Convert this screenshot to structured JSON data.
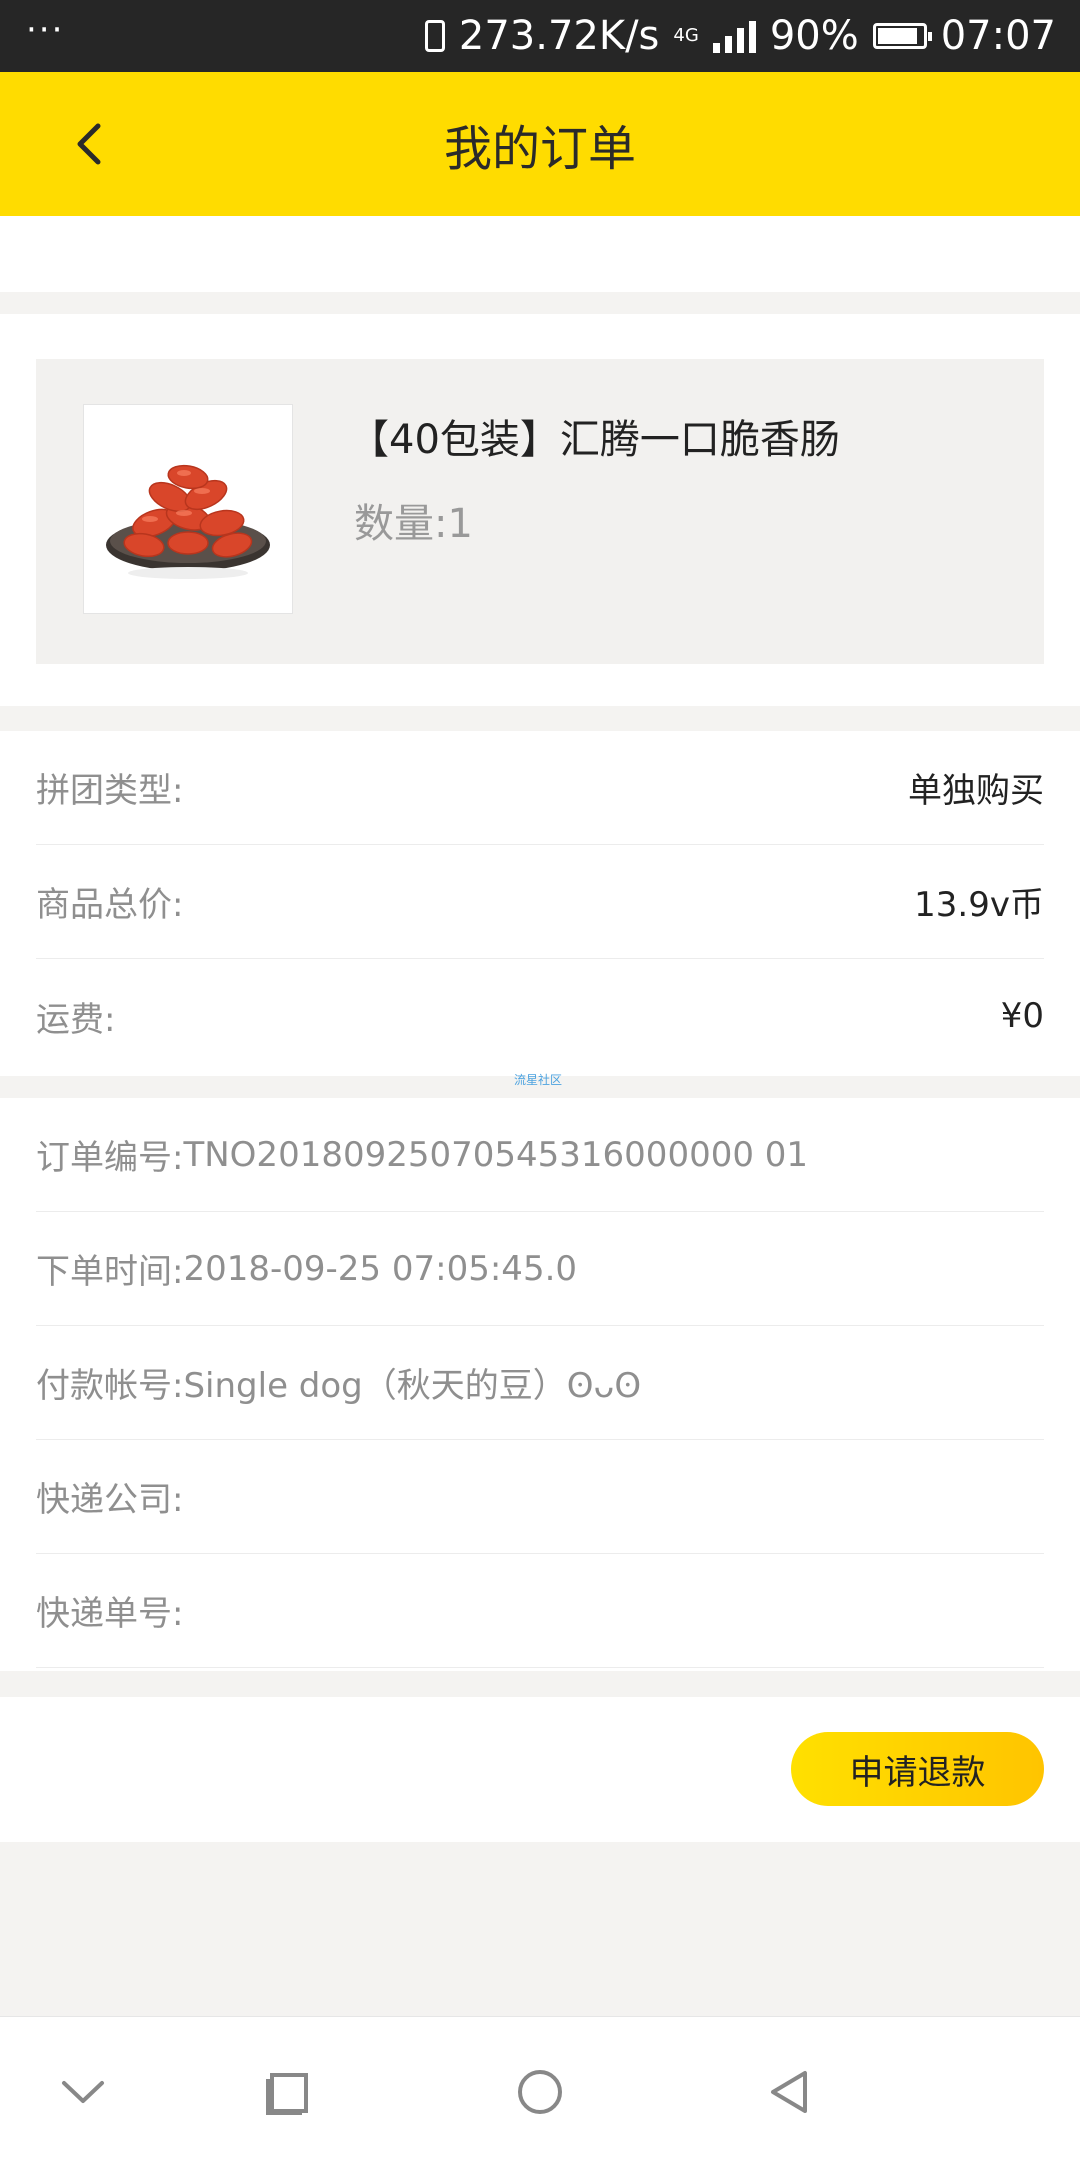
{
  "status_bar": {
    "menu": "···",
    "speed": "273.72K/s",
    "network": "4G",
    "battery": "90%",
    "battery_level": 0.9,
    "time": "07:07"
  },
  "header": {
    "title": "我的订单"
  },
  "product": {
    "name": "【40包装】汇腾一口脆香肠",
    "quantity": "数量:1"
  },
  "summary": {
    "rows": [
      {
        "label": "拼团类型:",
        "value": "单独购买"
      },
      {
        "label": "商品总价:",
        "value": "13.9v币"
      },
      {
        "label": "运费:",
        "value": "¥0"
      }
    ]
  },
  "watermark": "流星社区",
  "details": {
    "rows": [
      {
        "label": "订单编号:",
        "value": "TNO20180925070545316000000 01"
      },
      {
        "label": "下单时间:",
        "value": "2018-09-25 07:05:45.0"
      },
      {
        "label": "付款帐号:",
        "value": "Single dog（秋天的豆）ʘᴗʘ"
      },
      {
        "label": "快递公司:",
        "value": ""
      },
      {
        "label": "快递单号:",
        "value": ""
      }
    ]
  },
  "actions": {
    "refund": "申请退款"
  },
  "colors": {
    "accent": "#ffdc00",
    "status_bar": "#262626"
  },
  "nav": {
    "icons": [
      "chevron-down-icon",
      "square-icon",
      "circle-icon",
      "back-triangle-icon"
    ]
  }
}
